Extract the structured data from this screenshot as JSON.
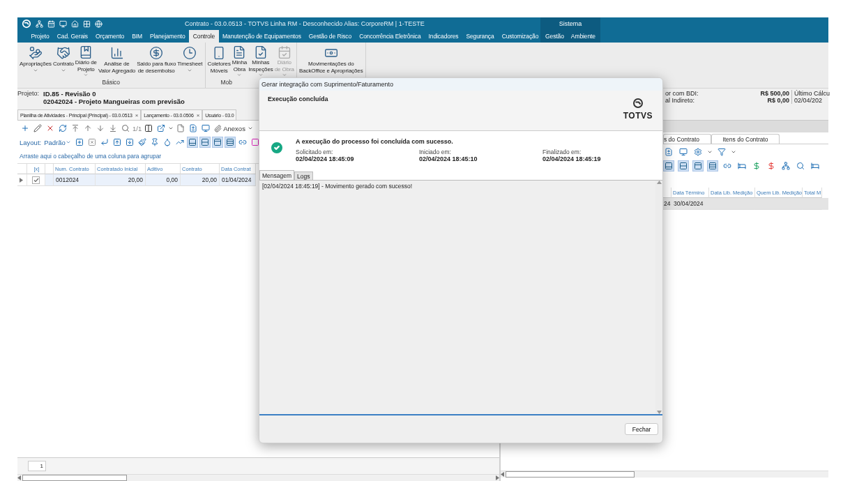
{
  "title_bar": {
    "title": "Contrato - 03.0.0513 - TOTVS Linha RM - Desconhecido  Alias: CorporeRM | 1-TESTE"
  },
  "menu": {
    "tabs": [
      {
        "label": "Projeto",
        "selected": false
      },
      {
        "label": "Cad. Gerais",
        "selected": false
      },
      {
        "label": "Orçamento",
        "selected": false
      },
      {
        "label": "BIM",
        "selected": false
      },
      {
        "label": "Planejamento",
        "selected": false
      },
      {
        "label": "Controle",
        "selected": true
      },
      {
        "label": "Manutenção de Equipamentos",
        "selected": false
      },
      {
        "label": "Gestão de Risco",
        "selected": false
      },
      {
        "label": "Concorrência Eletrônica",
        "selected": false
      },
      {
        "label": "Indicadores",
        "selected": false
      },
      {
        "label": "Segurança",
        "selected": false
      },
      {
        "label": "Customização",
        "selected": false
      }
    ]
  },
  "system_menu": {
    "label": "Sistema",
    "tabs": [
      {
        "label": "Gestão",
        "selected": false
      },
      {
        "label": "Ambiente",
        "selected": false
      }
    ]
  },
  "ribbon": {
    "groups": [
      {
        "label": "Básico",
        "buttons": [
          {
            "label": "Apropriações",
            "caret": true,
            "disabled": false
          },
          {
            "label": "Contrato",
            "caret": true,
            "disabled": false
          },
          {
            "label": "Diário de\nProjeto",
            "caret": true,
            "disabled": false
          },
          {
            "label": "Análise de\nValor Agregado",
            "caret": false,
            "disabled": false
          },
          {
            "label": "Saldo para fluxo\nde desembolso",
            "caret": false,
            "disabled": false
          },
          {
            "label": "Timesheet",
            "caret": true,
            "disabled": false
          }
        ]
      },
      {
        "label": "Mob",
        "buttons": [
          {
            "label": "Coletores\nMóveis",
            "caret": false,
            "disabled": false
          },
          {
            "label": "Minha\nObra",
            "caret": true,
            "disabled": false
          },
          {
            "label": "Minhas\nInspeções",
            "caret": true,
            "disabled": false
          },
          {
            "label": "Diário\nde Obra",
            "caret": true,
            "disabled": true
          }
        ]
      },
      {
        "buttons": [
          {
            "label": "Movimentações do\nBackOffice e Apropriações",
            "caret": false,
            "disabled": false
          }
        ]
      }
    ]
  },
  "project": {
    "label": "Projeto:",
    "lines": [
      "ID.85 - Revisão 0",
      "02042024 - Projeto Mangueiras com  previsão"
    ],
    "summary": [
      {
        "label": "or com BDI:",
        "value": "R$ 500,00",
        "extra": "Último Cálcu"
      },
      {
        "label": "al Indireto:",
        "value": "R$ 0,00",
        "extra": "02/04/202"
      }
    ]
  },
  "doc_tabs": [
    {
      "label": "Planilha de Atividades - Principal (Principal) - 03.0.0513",
      "close": "×"
    },
    {
      "label": "Lançamento - 03.0.0506",
      "close": "×"
    },
    {
      "label": "Usuário - 03.0"
    }
  ],
  "left_pane": {
    "page": "1/1",
    "attachments": "Anexos",
    "layout_label": "Layout:",
    "layout_value": "Padrão",
    "group_hint": "Arraste aqui o cabeçalho de uma coluna para agrupar",
    "check_column": "[x]",
    "columns": [
      "Num. Contrato",
      "Contratado Inicial",
      "Aditivo",
      "Contrato",
      "Data Contrat"
    ],
    "rows": [
      {
        "checked": true,
        "selected": true,
        "cells": [
          "0012024",
          "20,00",
          "0,00",
          "20,00",
          "01/04/2024"
        ]
      }
    ],
    "pager": "1"
  },
  "right_pane": {
    "tabs": [
      {
        "label": "s do Contrato"
      },
      {
        "label": "Itens do Contrato"
      }
    ],
    "columns": [
      "Data Término",
      "Data Lib. Medição",
      "Quem Lib. Medição",
      "Total M"
    ],
    "rows": [
      {
        "partial": "24",
        "cells": [
          "30/04/2024"
        ]
      }
    ]
  },
  "dialog": {
    "title": "Gerar integração com Suprimento/Faturamento",
    "heading": "Execução concluída",
    "logo": "TOTVS",
    "message": "A execução do processo foi concluída com sucesso.",
    "times": [
      {
        "label": "Solicitado em:",
        "value": "02/04/2024 18:45:09"
      },
      {
        "label": "Iniciado em:",
        "value": "02/04/2024 18:45:10"
      },
      {
        "label": "Finalizado em:",
        "value": "02/04/2024 18:45:19"
      }
    ],
    "tabs": [
      {
        "label": "Mensagem",
        "selected": true
      },
      {
        "label": "Logs",
        "selected": false
      }
    ],
    "log": "[02/04/2024 18:45:19] - Movimento gerado com sucesso!",
    "close_button": "Fechar"
  }
}
